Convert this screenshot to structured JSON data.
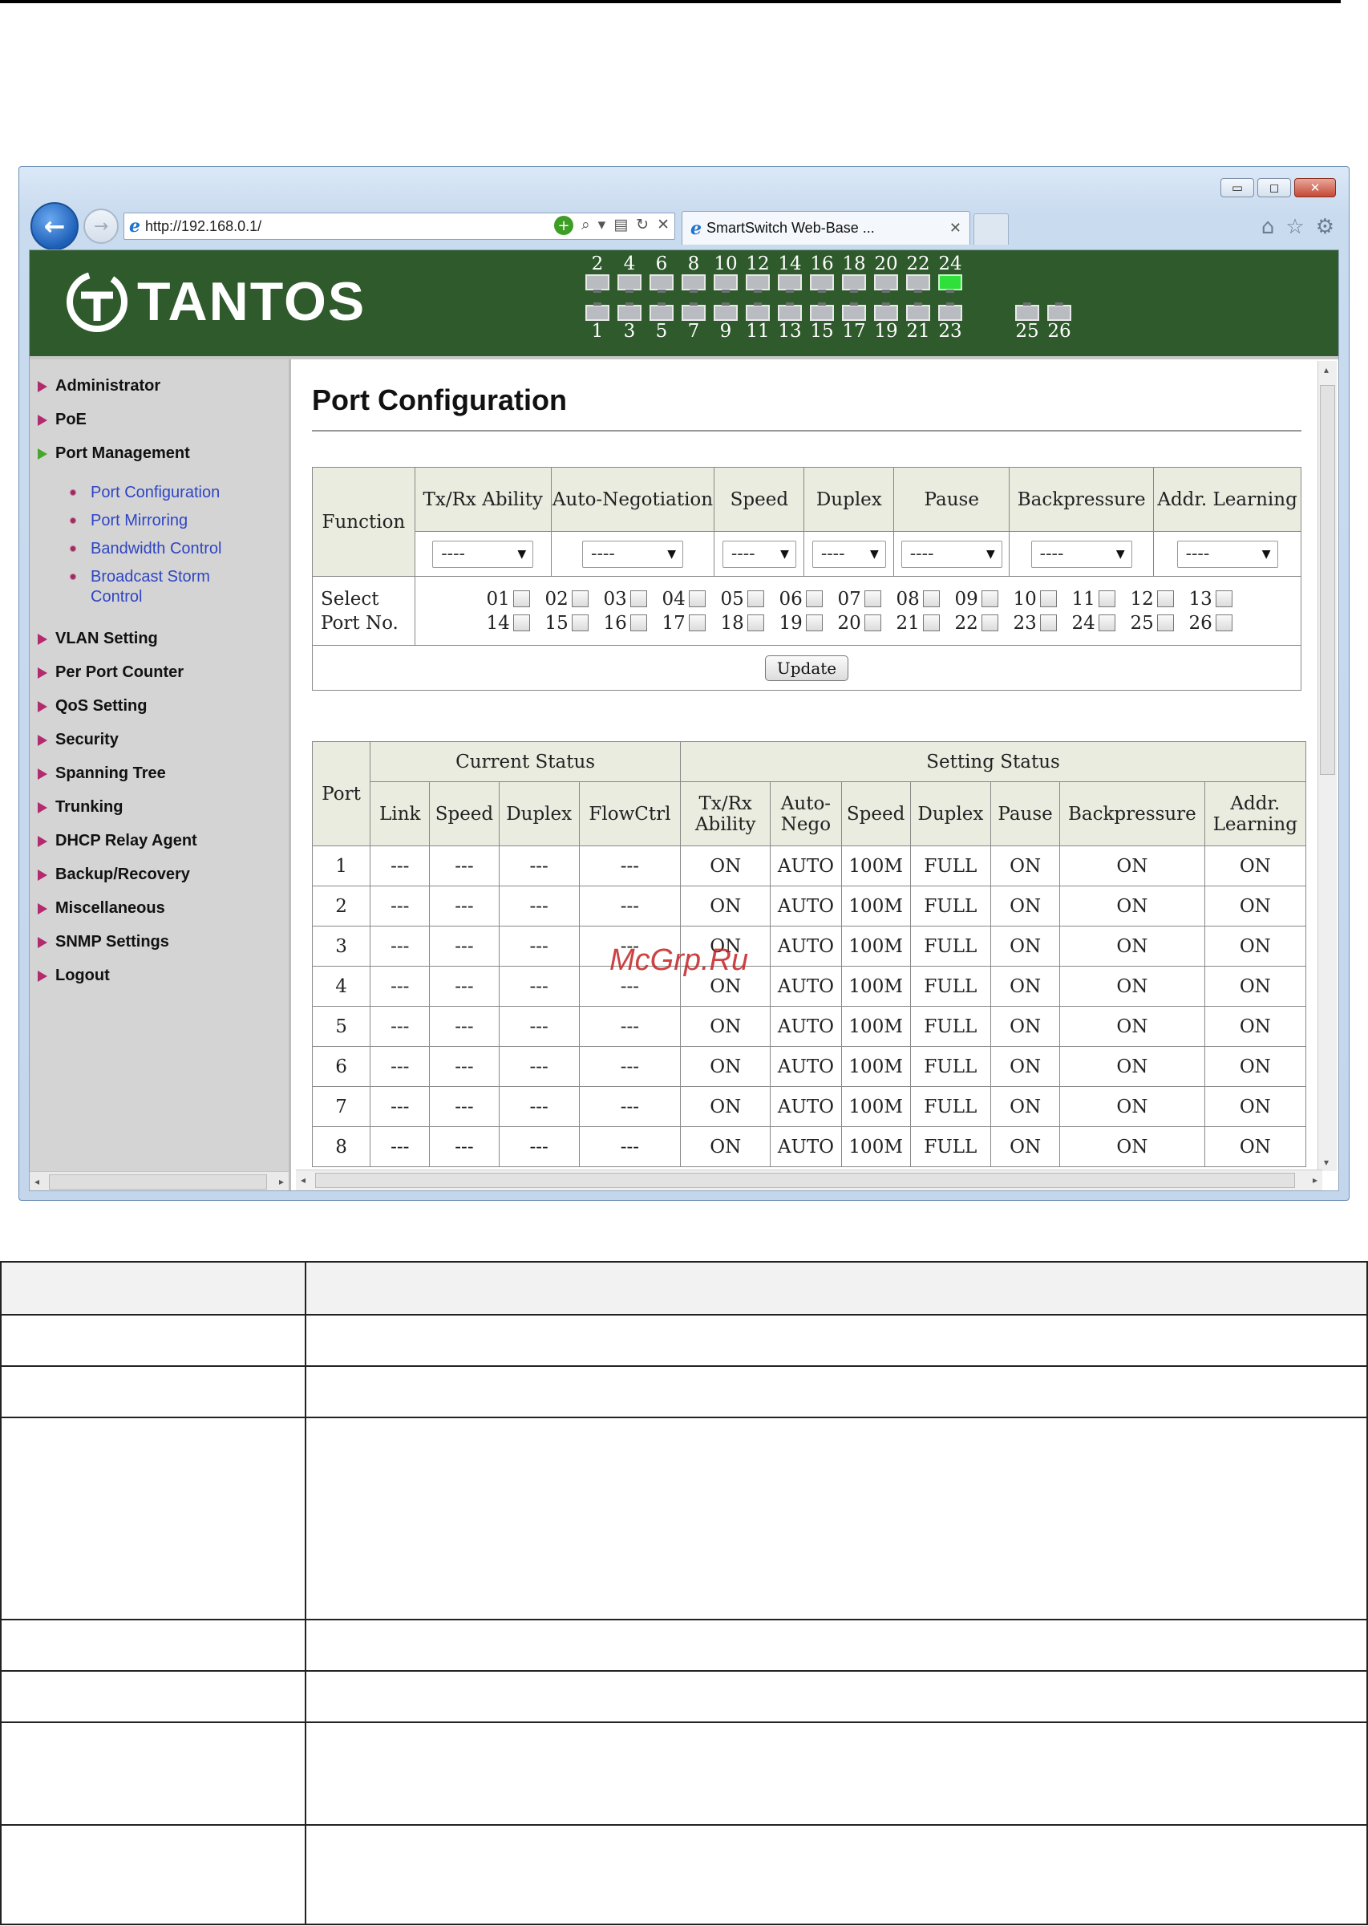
{
  "browser": {
    "url": "http://192.168.0.1/",
    "tab_title": "SmartSwitch Web-Base ...",
    "tab_close": "✕",
    "window_controls": [
      "minimize-icon",
      "maximize-icon",
      "close-icon"
    ],
    "toolbar_icons": [
      "home-icon",
      "star-icon",
      "gear-icon"
    ]
  },
  "banner": {
    "logo_text": "TANTOS",
    "ports_top": [
      {
        "num": "2",
        "up": false
      },
      {
        "num": "4",
        "up": false
      },
      {
        "num": "6",
        "up": false
      },
      {
        "num": "8",
        "up": false
      },
      {
        "num": "10",
        "up": false
      },
      {
        "num": "12",
        "up": false
      },
      {
        "num": "14",
        "up": false
      },
      {
        "num": "16",
        "up": false
      },
      {
        "num": "18",
        "up": false
      },
      {
        "num": "20",
        "up": false
      },
      {
        "num": "22",
        "up": false
      },
      {
        "num": "24",
        "up": true
      }
    ],
    "ports_bottom": [
      "1",
      "3",
      "5",
      "7",
      "9",
      "11",
      "13",
      "15",
      "17",
      "19",
      "21",
      "23"
    ],
    "ports_extra": [
      "25",
      "26"
    ],
    "link_color": "#2fe03a"
  },
  "sidebar": {
    "items": [
      {
        "label": "Administrator"
      },
      {
        "label": "PoE"
      },
      {
        "label": "Port Management",
        "open": true
      },
      {
        "label": "VLAN Setting"
      },
      {
        "label": "Per Port Counter"
      },
      {
        "label": "QoS Setting"
      },
      {
        "label": "Security"
      },
      {
        "label": "Spanning Tree"
      },
      {
        "label": "Trunking"
      },
      {
        "label": "DHCP Relay Agent"
      },
      {
        "label": "Backup/Recovery"
      },
      {
        "label": "Miscellaneous"
      },
      {
        "label": "SNMP Settings"
      },
      {
        "label": "Logout"
      }
    ],
    "submenu": [
      "Port Configuration",
      "Port Mirroring",
      "Bandwidth Control",
      "Broadcast Storm Control"
    ]
  },
  "main": {
    "title": "Port Configuration",
    "config": {
      "function_label": "Function",
      "headers": [
        "Tx/Rx Ability",
        "Auto-Negotiation",
        "Speed",
        "Duplex",
        "Pause",
        "Backpressure",
        "Addr. Learning"
      ],
      "select_value": "----",
      "select_port_label": "Select Port No.",
      "ports": [
        "01",
        "02",
        "03",
        "04",
        "05",
        "06",
        "07",
        "08",
        "09",
        "10",
        "11",
        "12",
        "13",
        "14",
        "15",
        "16",
        "17",
        "18",
        "19",
        "20",
        "21",
        "22",
        "23",
        "24",
        "25",
        "26"
      ],
      "update_label": "Update"
    },
    "status": {
      "port_label": "Port",
      "current_status_label": "Current Status",
      "setting_status_label": "Setting Status",
      "current_cols": [
        "Link",
        "Speed",
        "Duplex",
        "FlowCtrl"
      ],
      "setting_cols": [
        "Tx/Rx Ability",
        "Auto-Nego",
        "Speed",
        "Duplex",
        "Pause",
        "Backpressure",
        "Addr. Learning"
      ],
      "rows": [
        [
          "1",
          "---",
          "---",
          "---",
          "---",
          "ON",
          "AUTO",
          "100M",
          "FULL",
          "ON",
          "ON",
          "ON"
        ],
        [
          "2",
          "---",
          "---",
          "---",
          "---",
          "ON",
          "AUTO",
          "100M",
          "FULL",
          "ON",
          "ON",
          "ON"
        ],
        [
          "3",
          "---",
          "---",
          "---",
          "---",
          "ON",
          "AUTO",
          "100M",
          "FULL",
          "ON",
          "ON",
          "ON"
        ],
        [
          "4",
          "---",
          "---",
          "---",
          "---",
          "ON",
          "AUTO",
          "100M",
          "FULL",
          "ON",
          "ON",
          "ON"
        ],
        [
          "5",
          "---",
          "---",
          "---",
          "---",
          "ON",
          "AUTO",
          "100M",
          "FULL",
          "ON",
          "ON",
          "ON"
        ],
        [
          "6",
          "---",
          "---",
          "---",
          "---",
          "ON",
          "AUTO",
          "100M",
          "FULL",
          "ON",
          "ON",
          "ON"
        ],
        [
          "7",
          "---",
          "---",
          "---",
          "---",
          "ON",
          "AUTO",
          "100M",
          "FULL",
          "ON",
          "ON",
          "ON"
        ],
        [
          "8",
          "---",
          "---",
          "---",
          "---",
          "ON",
          "AUTO",
          "100M",
          "FULL",
          "ON",
          "ON",
          "ON"
        ]
      ]
    }
  },
  "watermark": "McGrp.Ru"
}
